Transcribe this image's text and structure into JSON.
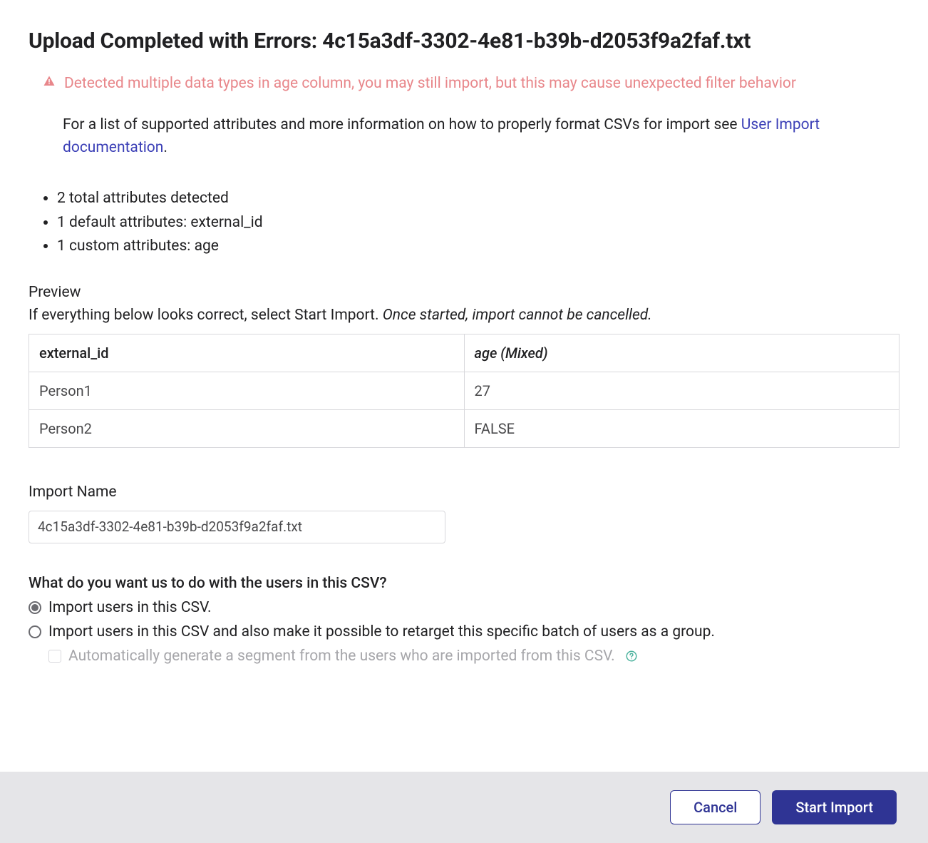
{
  "header": {
    "title": "Upload Completed with Errors: 4c15a3df-3302-4e81-b39b-d2053f9a2faf.txt"
  },
  "alert": {
    "text": "Detected multiple data types in age column, you may still import, but this may cause unexpected filter behavior"
  },
  "info": {
    "prefix": "For a list of supported attributes and more information on how to properly format CSVs for import see ",
    "link_text": "User Import documentation",
    "suffix": "."
  },
  "attributes": {
    "total": "2 total attributes detected",
    "default_label": "1 default attributes",
    "default_value": ": external_id",
    "custom_label": "1 custom attributes",
    "custom_value": ": age"
  },
  "preview": {
    "label": "Preview",
    "hint_plain": "If everything below looks correct, select Start Import. ",
    "hint_italic": "Once started, import cannot be cancelled.",
    "columns": [
      "external_id",
      "age (Mixed)"
    ],
    "rows": [
      [
        "Person1",
        "27"
      ],
      [
        "Person2",
        "FALSE"
      ]
    ]
  },
  "import_name": {
    "label": "Import Name",
    "value": "4c15a3df-3302-4e81-b39b-d2053f9a2faf.txt"
  },
  "question": {
    "label": "What do you want us to do with the users in this CSV?",
    "options": [
      "Import users in this CSV.",
      "Import users in this CSV and also make it possible to retarget this specific batch of users as a group."
    ],
    "checkbox": "Automatically generate a segment from the users who are imported from this CSV."
  },
  "footer": {
    "cancel": "Cancel",
    "start": "Start Import"
  }
}
